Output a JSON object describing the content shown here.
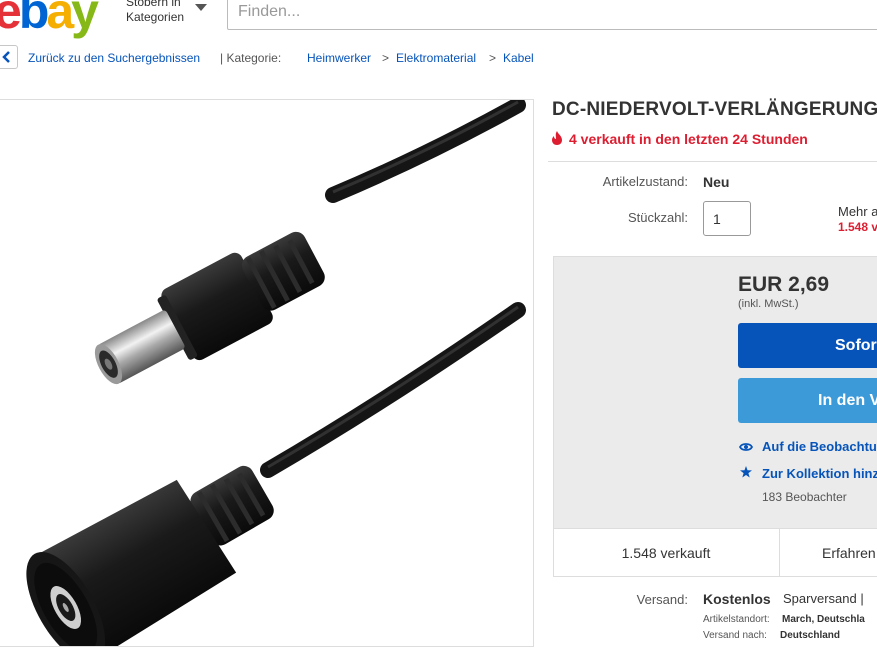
{
  "header": {
    "logo_letters": [
      "e",
      "b",
      "a",
      "y"
    ],
    "shop_by_category": "Stöbern in Kategorien",
    "search_placeholder": "Finden..."
  },
  "breadcrumb": {
    "back_label": "Zurück zu den Suchergebnissen",
    "category_label": "| Kategorie:",
    "items": [
      "Heimwerker",
      "Elektromaterial",
      "Kabel"
    ],
    "separator": ">"
  },
  "item": {
    "title": "DC-NIEDERVOLT-VERLÄNGERUNG",
    "sold_recent": "4 verkauft in den letzten 24 Stunden",
    "condition_label": "Artikelzustand:",
    "condition_value": "Neu",
    "quantity_label": "Stückzahl:",
    "quantity_value": "1",
    "more_available": "Mehr a",
    "more_sold": "1.548 v"
  },
  "buybox": {
    "price": "EUR 2,69",
    "price_note": "(inkl. MwSt.)",
    "buy_now": "Sofor",
    "add_to_cart": "In den V",
    "watch_link": "Auf die Beobachtu",
    "collection_link": "Zur Kollektion hinz",
    "watchers": "183 Beobachter",
    "sold_count": "1.548 verkauft",
    "experience": "Erfahren"
  },
  "shipping": {
    "label": "Versand:",
    "value": "Kostenlos",
    "type": "Sparversand | ",
    "location_label": "Artikelstandort:",
    "location_value": "March, Deutschla",
    "to_label": "Versand nach:",
    "to_value": "Deutschland"
  },
  "colors": {
    "ebay_red": "#e53238",
    "ebay_blue": "#0064d2",
    "ebay_yellow": "#f5af02",
    "ebay_green": "#86b817",
    "link_blue": "#0654ba",
    "alert_red": "#dd1e31",
    "buy_button": "#0654ba",
    "cart_button": "#3d9ad8"
  }
}
